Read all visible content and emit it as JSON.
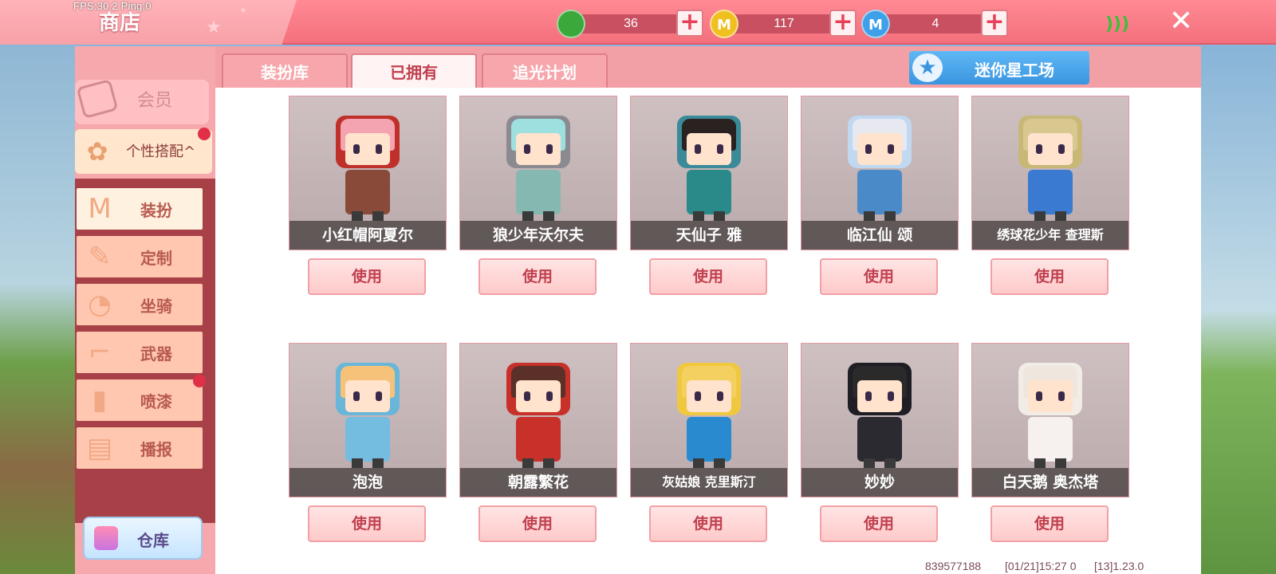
{
  "hud": {
    "fps": "FPS:30.2  Ping:0"
  },
  "header": {
    "title": "商店",
    "currencies": [
      {
        "icon": "green-gem-icon",
        "symbol": "",
        "value": "36",
        "color": "#3aa83a"
      },
      {
        "icon": "gold-coin-icon",
        "symbol": "M",
        "value": "117",
        "color": "#f0c020"
      },
      {
        "icon": "blue-coin-icon",
        "symbol": "M",
        "value": "4",
        "color": "#3ea0e8"
      }
    ],
    "plus": "+",
    "close": "✕",
    "signal": ")))"
  },
  "sidebar": {
    "vip": "会员",
    "group": "个性搭配",
    "group_arrow": "^",
    "items": [
      {
        "label": "装扮",
        "icon": "shirt-icon",
        "glyph": "M",
        "active": true,
        "badge": false
      },
      {
        "label": "定制",
        "icon": "brush-icon",
        "glyph": "✎",
        "active": false,
        "badge": false
      },
      {
        "label": "坐骑",
        "icon": "mount-icon",
        "glyph": "◔",
        "active": false,
        "badge": false
      },
      {
        "label": "武器",
        "icon": "gun-icon",
        "glyph": "⌐",
        "active": false,
        "badge": false
      },
      {
        "label": "喷漆",
        "icon": "spray-icon",
        "glyph": "▮",
        "active": false,
        "badge": true
      },
      {
        "label": "播报",
        "icon": "broadcast-icon",
        "glyph": "▤",
        "active": false,
        "badge": false
      }
    ],
    "warehouse": "仓库"
  },
  "tabs": [
    {
      "label": "装扮库",
      "active": false
    },
    {
      "label": "已拥有",
      "active": true
    },
    {
      "label": "追光计划",
      "active": false
    }
  ],
  "spark_button": {
    "label": "迷你星工场",
    "glyph": "★"
  },
  "use_label": "使用",
  "skins": [
    {
      "name": "小红帽阿夏尔",
      "hair": "#f4a3b0",
      "hood": "#c0302a",
      "body": "#8a4a3a"
    },
    {
      "name": "狼少年沃尔夫",
      "hair": "#9ee0e0",
      "hood": "#8a8a90",
      "body": "#86b8b2"
    },
    {
      "name": "天仙子 雅",
      "hair": "#2a2220",
      "hood": "#3a8a9a",
      "body": "#2a8a8a"
    },
    {
      "name": "临江仙 颂",
      "hair": "#e8e8f0",
      "hood": "#c0d8f0",
      "body": "#4a8ac8"
    },
    {
      "name": "绣球花少年 查理斯",
      "hair": "#d8c890",
      "hood": "#c8b878",
      "body": "#3a7ad0"
    },
    {
      "name": "泡泡",
      "hair": "#f6c27a",
      "hood": "#6ab6d8",
      "body": "#74bce0"
    },
    {
      "name": "朝露繁花",
      "hair": "#5a3028",
      "hood": "#c8302a",
      "body": "#c8302a"
    },
    {
      "name": "灰姑娘 克里斯汀",
      "hair": "#f4d060",
      "hood": "#f0c840",
      "body": "#2a8ad0"
    },
    {
      "name": "妙妙",
      "hair": "#2a2a2a",
      "hood": "#1e1e24",
      "body": "#2a2a30"
    },
    {
      "name": "白天鹅 奥杰塔",
      "hair": "#efe6de",
      "hood": "#f2ece6",
      "body": "#f6f0ee"
    }
  ],
  "footer": {
    "uid": "839577188",
    "time": "[01/21]15:27 0",
    "version": "[13]1.23.0"
  }
}
